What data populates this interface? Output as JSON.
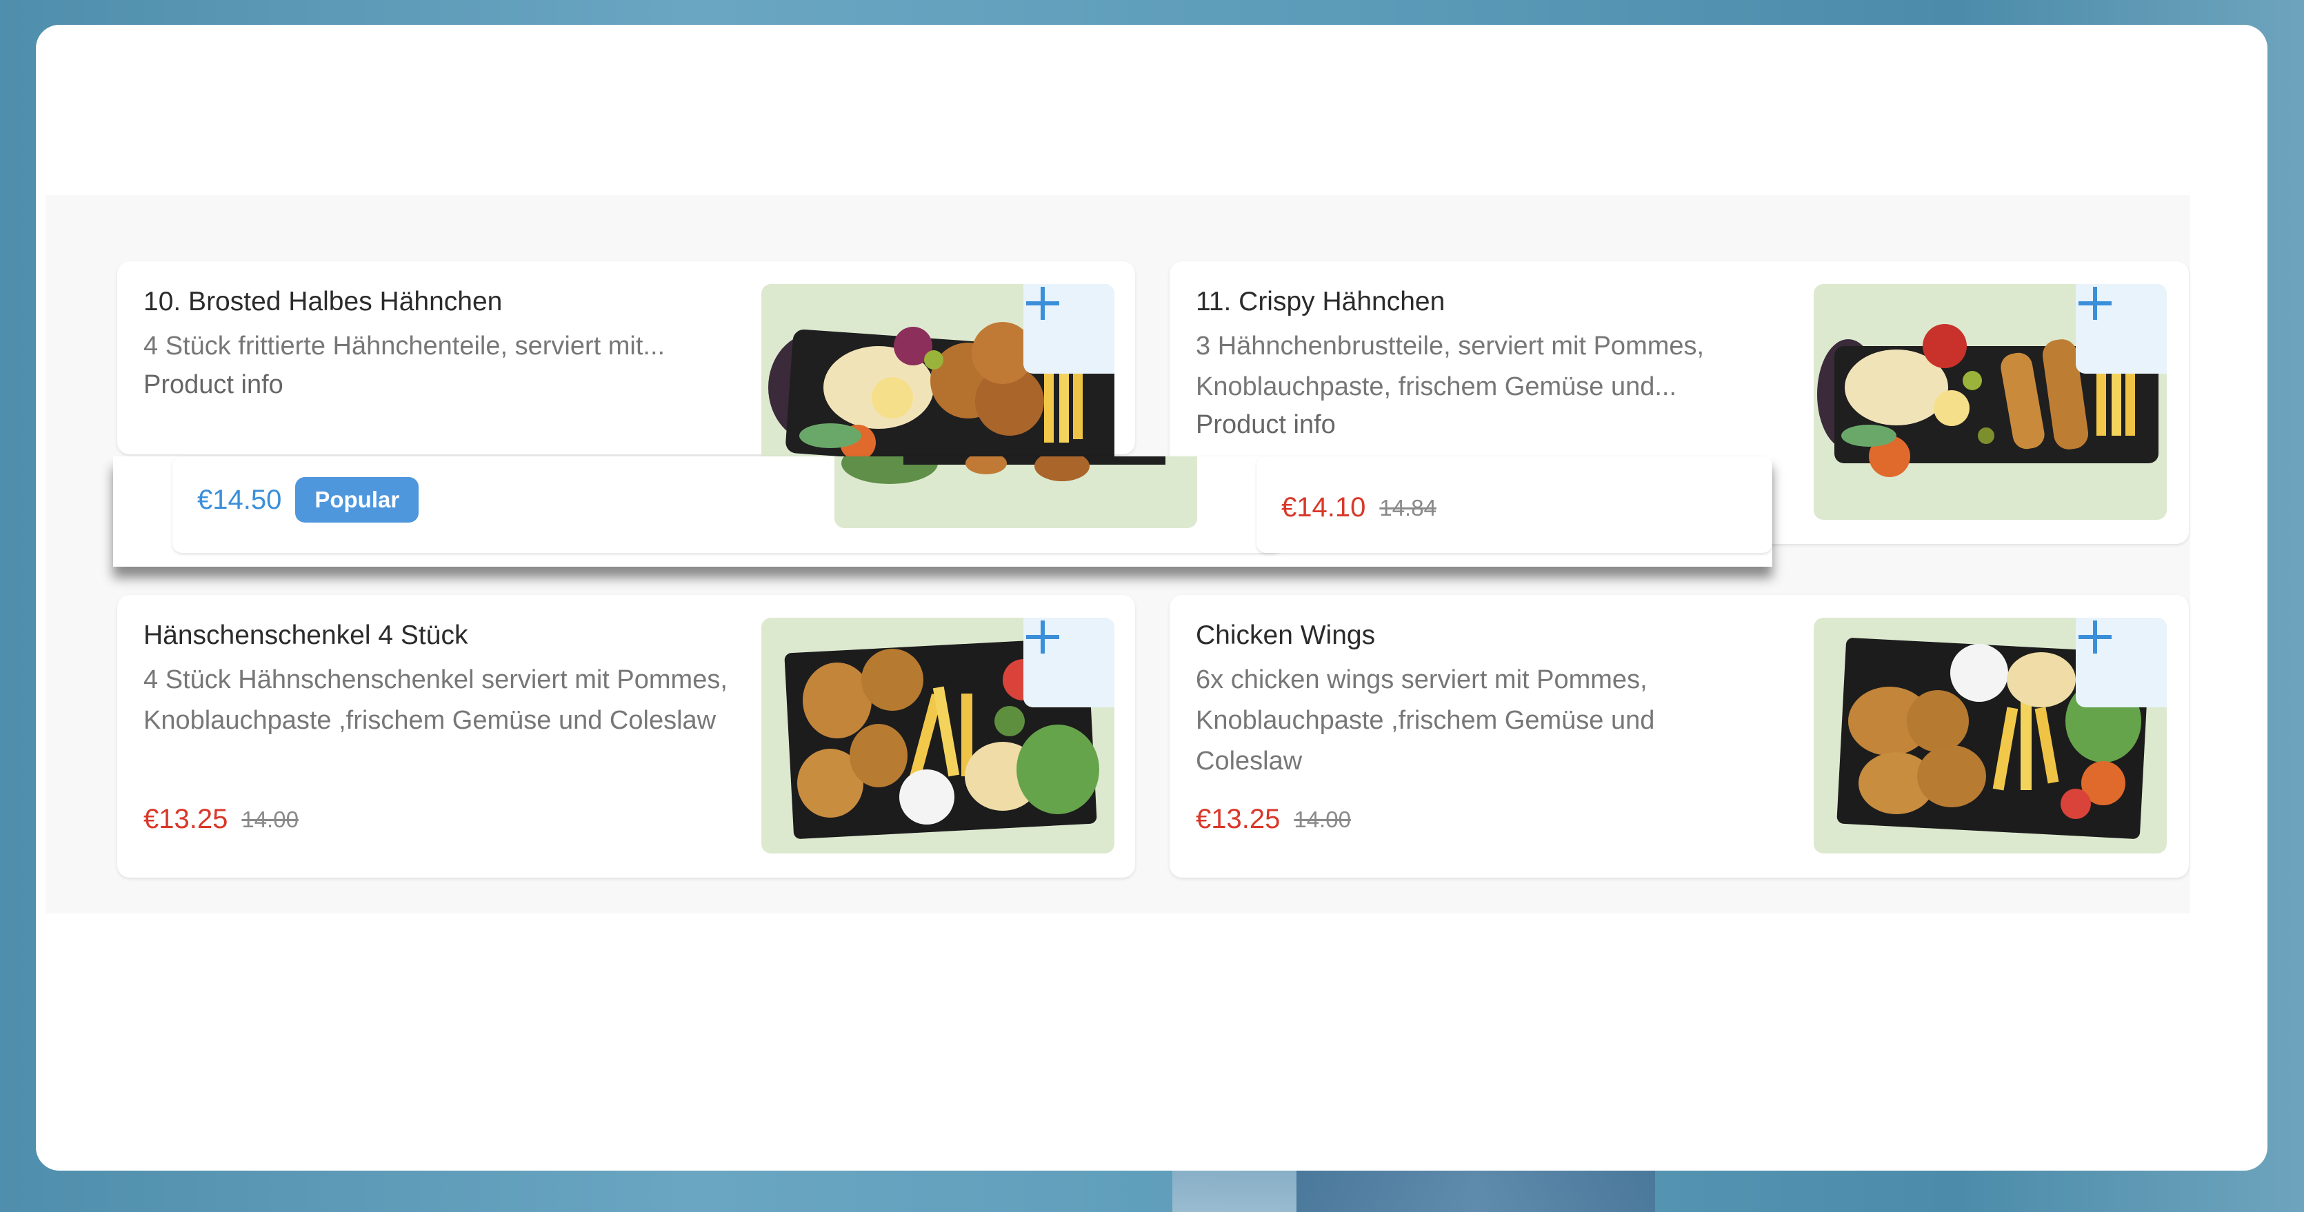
{
  "colors": {
    "accent": "#3b8fd9",
    "sale_price": "#d9382a",
    "badge": "#4e97dd",
    "image_bg": "#dde9cf"
  },
  "icons": {
    "add": "plus-icon"
  },
  "cards": [
    {
      "title": "10. Brosted Halbes Hähnchen",
      "description": "4 Stück frittierte Hähnchenteile, serviert mit...",
      "product_info": "Product info",
      "price": "€14.50",
      "badge": "Popular"
    },
    {
      "title": "11. Crispy Hähnchen",
      "description": "3 Hähnchenbrustteile, serviert mit Pommes, Knoblauchpaste, frischem Gemüse und...",
      "product_info": "Product info",
      "price": "€14.10",
      "old_price": "14.84"
    },
    {
      "title": "Hänschenschenkel 4 Stück",
      "description": "4 Stück Hähnschenschenkel serviert mit Pommes, Knoblauchpaste ,frischem Gemüse und Coleslaw",
      "price": "€13.25",
      "old_price": "14.00"
    },
    {
      "title": "Chicken Wings",
      "description": "6x chicken wings serviert mit Pommes, Knoblauchpaste ,frischem Gemüse und Coleslaw",
      "price": "€13.25",
      "old_price": "14.00"
    }
  ]
}
